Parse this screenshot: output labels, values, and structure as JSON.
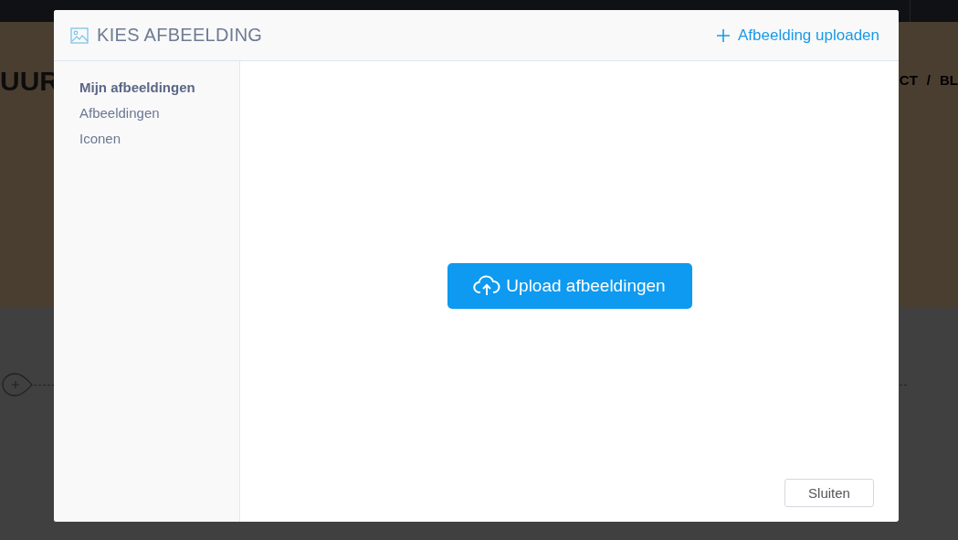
{
  "background": {
    "logo": "UUR",
    "nav": [
      "CT",
      "/",
      "BL"
    ]
  },
  "dialog": {
    "title": "KIES AFBEELDING",
    "upload_link": "Afbeelding uploaden",
    "sidebar": {
      "items": [
        {
          "label": "Mijn afbeeldingen",
          "selected": true
        },
        {
          "label": "Afbeeldingen",
          "selected": false
        },
        {
          "label": "Iconen",
          "selected": false
        }
      ]
    },
    "upload_button": "Upload afbeeldingen",
    "close_button": "Sluiten"
  }
}
